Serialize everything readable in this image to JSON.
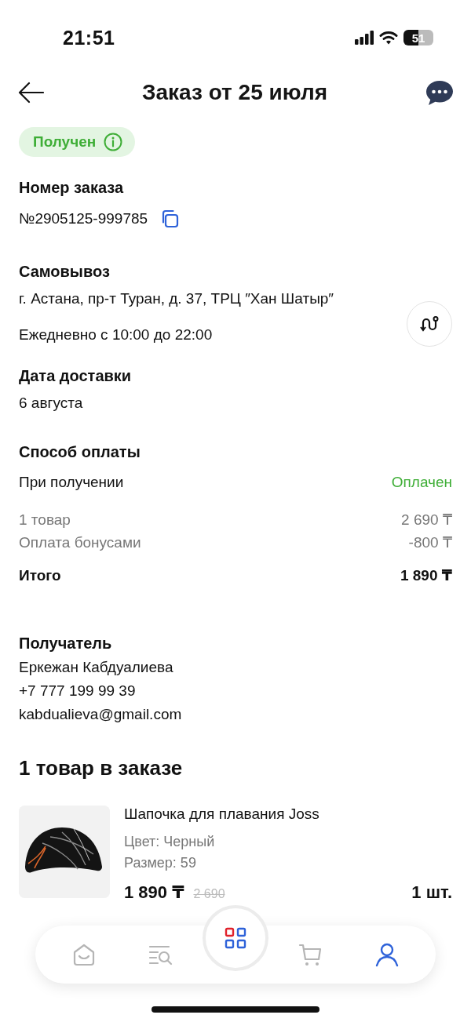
{
  "status_bar": {
    "time": "21:51",
    "battery": "51"
  },
  "header": {
    "title": "Заказ от 25 июля"
  },
  "status_badge": {
    "label": "Получен"
  },
  "order_number": {
    "label": "Номер заказа",
    "value": "№2905125-999785"
  },
  "pickup": {
    "label": "Самовывоз",
    "address": "г. Астана, пр-т Туран, д. 37, ТРЦ ″Хан Шатыр″",
    "hours": "Ежедневно с 10:00 до 22:00"
  },
  "delivery_date": {
    "label": "Дата доставки",
    "value": "6 августа"
  },
  "payment": {
    "label": "Способ оплаты",
    "method": "При получении",
    "status": "Оплачен",
    "lines": [
      {
        "label": "1 товар",
        "value": "2 690 ₸"
      },
      {
        "label": "Оплата бонусами",
        "value": "-800 ₸"
      }
    ],
    "total": {
      "label": "Итого",
      "value": "1 890 ₸"
    }
  },
  "recipient": {
    "label": "Получатель",
    "name": "Еркежан Кабдуалиева",
    "phone": "+7 777 199 99 39",
    "email": "kabdualieva@gmail.com"
  },
  "items": {
    "title": "1 товар в заказе",
    "products": [
      {
        "name": "Шапочка для плавания Joss",
        "variant": "Цвет: Черный",
        "size": "Размер: 59",
        "price": "1 890 ₸",
        "old_price": "2 690",
        "quantity": "1 шт."
      }
    ]
  },
  "nav": [
    {
      "kind": "home",
      "selected": false
    },
    {
      "kind": "search",
      "selected": false
    },
    {
      "kind": "catalog",
      "selected": false
    },
    {
      "kind": "cart",
      "selected": false
    },
    {
      "kind": "profile",
      "selected": true
    }
  ]
}
